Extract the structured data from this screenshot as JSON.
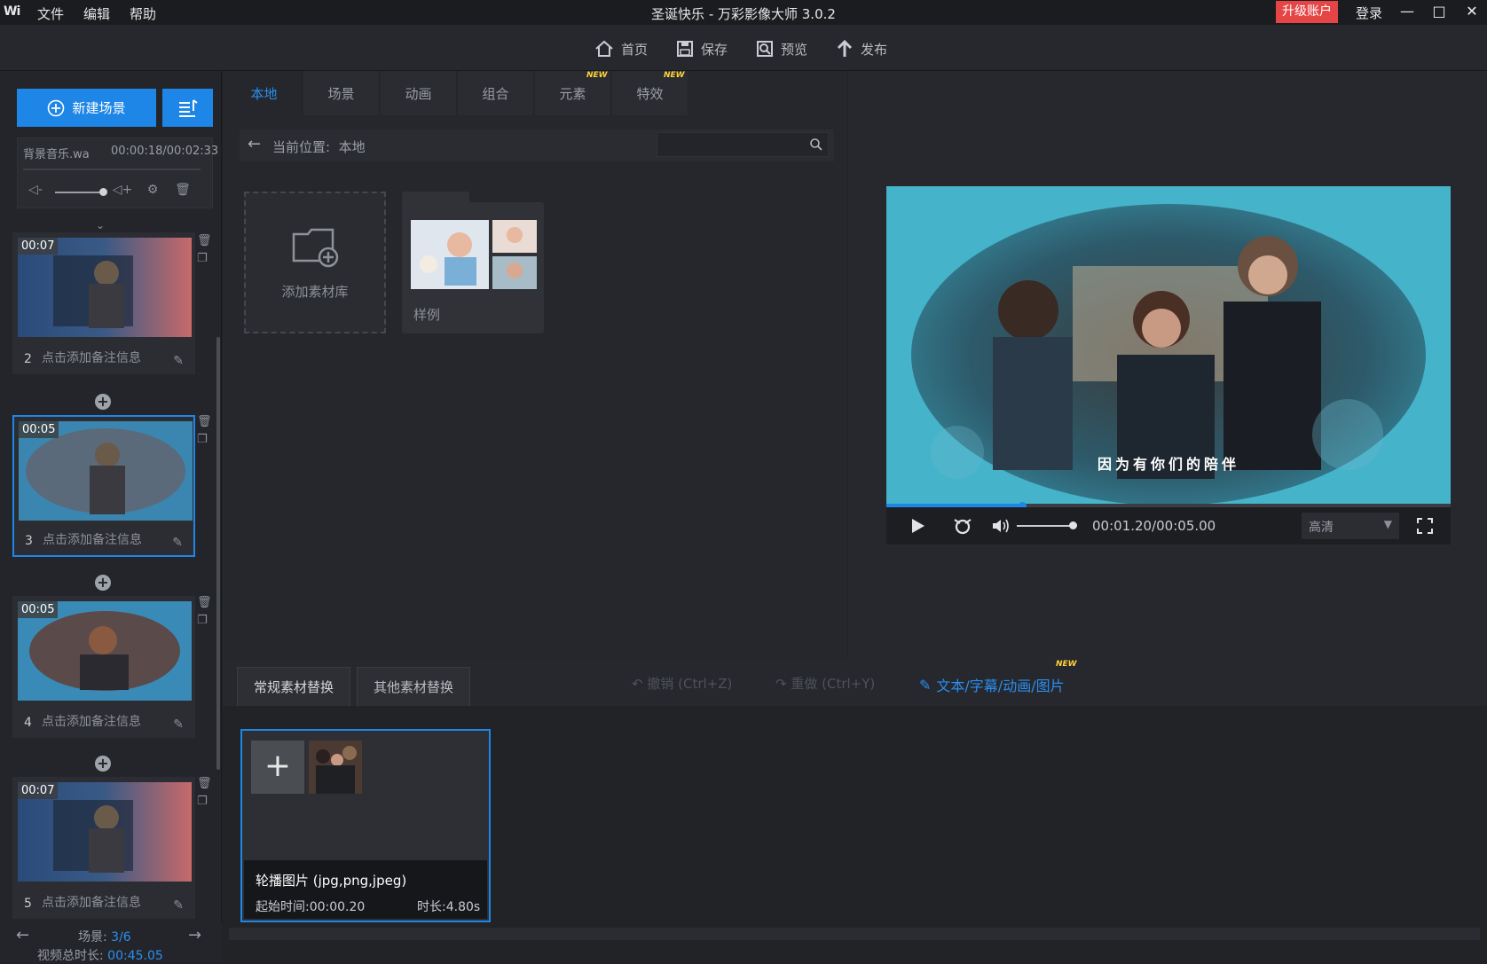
{
  "app": {
    "logo": "Wi",
    "title": "圣诞快乐 - 万彩影像大师 3.0.2"
  },
  "menu": [
    "文件",
    "编辑",
    "帮助"
  ],
  "account": {
    "upgrade": "升级账户",
    "login": "登录"
  },
  "window": {
    "minimize": "—",
    "maximize": "□",
    "close": "✕"
  },
  "toolbar": {
    "home": "首页",
    "save": "保存",
    "preview": "预览",
    "publish": "发布"
  },
  "left": {
    "new_scene": "新建场景",
    "music": {
      "name": "背景音乐.wa",
      "time": "00:00:18/00:02:33"
    },
    "scenes": [
      {
        "num": "2",
        "duration": "00:07",
        "note": "点击添加备注信息",
        "selected": false
      },
      {
        "num": "3",
        "duration": "00:05",
        "note": "点击添加备注信息",
        "selected": true
      },
      {
        "num": "4",
        "duration": "00:05",
        "note": "点击添加备注信息",
        "selected": false
      },
      {
        "num": "5",
        "duration": "00:07",
        "note": "点击添加备注信息",
        "selected": false
      }
    ],
    "scene_label": "场景:",
    "scene_current": "3/6",
    "total_label": "视频总时长:",
    "total_value": "00:45.05"
  },
  "library": {
    "tabs": [
      {
        "label": "本地",
        "active": true,
        "new": false
      },
      {
        "label": "场景",
        "active": false,
        "new": false
      },
      {
        "label": "动画",
        "active": false,
        "new": false
      },
      {
        "label": "组合",
        "active": false,
        "new": false
      },
      {
        "label": "元素",
        "active": false,
        "new": true
      },
      {
        "label": "特效",
        "active": false,
        "new": true
      }
    ],
    "new_badge": "NEW",
    "path_label": "当前位置:",
    "path_value": "本地",
    "search_placeholder": "",
    "add_library": "添加素材库",
    "sample_folder": "样例"
  },
  "preview": {
    "caption": "因为有你们的陪伴",
    "time": "00:01.20/00:05.00",
    "quality": "高清",
    "progress": 0.24,
    "volume": 0.7
  },
  "bottom": {
    "tabs": [
      "常规素材替换",
      "其他素材替换"
    ],
    "undo": "撤销 (Ctrl+Z)",
    "redo": "重做 (Ctrl+Y)",
    "text_edit": "文本/字幕/动画/图片",
    "card": {
      "title": "轮播图片 (jpg,png,jpeg)",
      "start": "起始时间:00:00.20",
      "duration": "时长:4.80s"
    }
  },
  "colors": {
    "accent": "#1e86e6",
    "upgrade": "#e64545",
    "new_badge": "#ffd23a"
  }
}
